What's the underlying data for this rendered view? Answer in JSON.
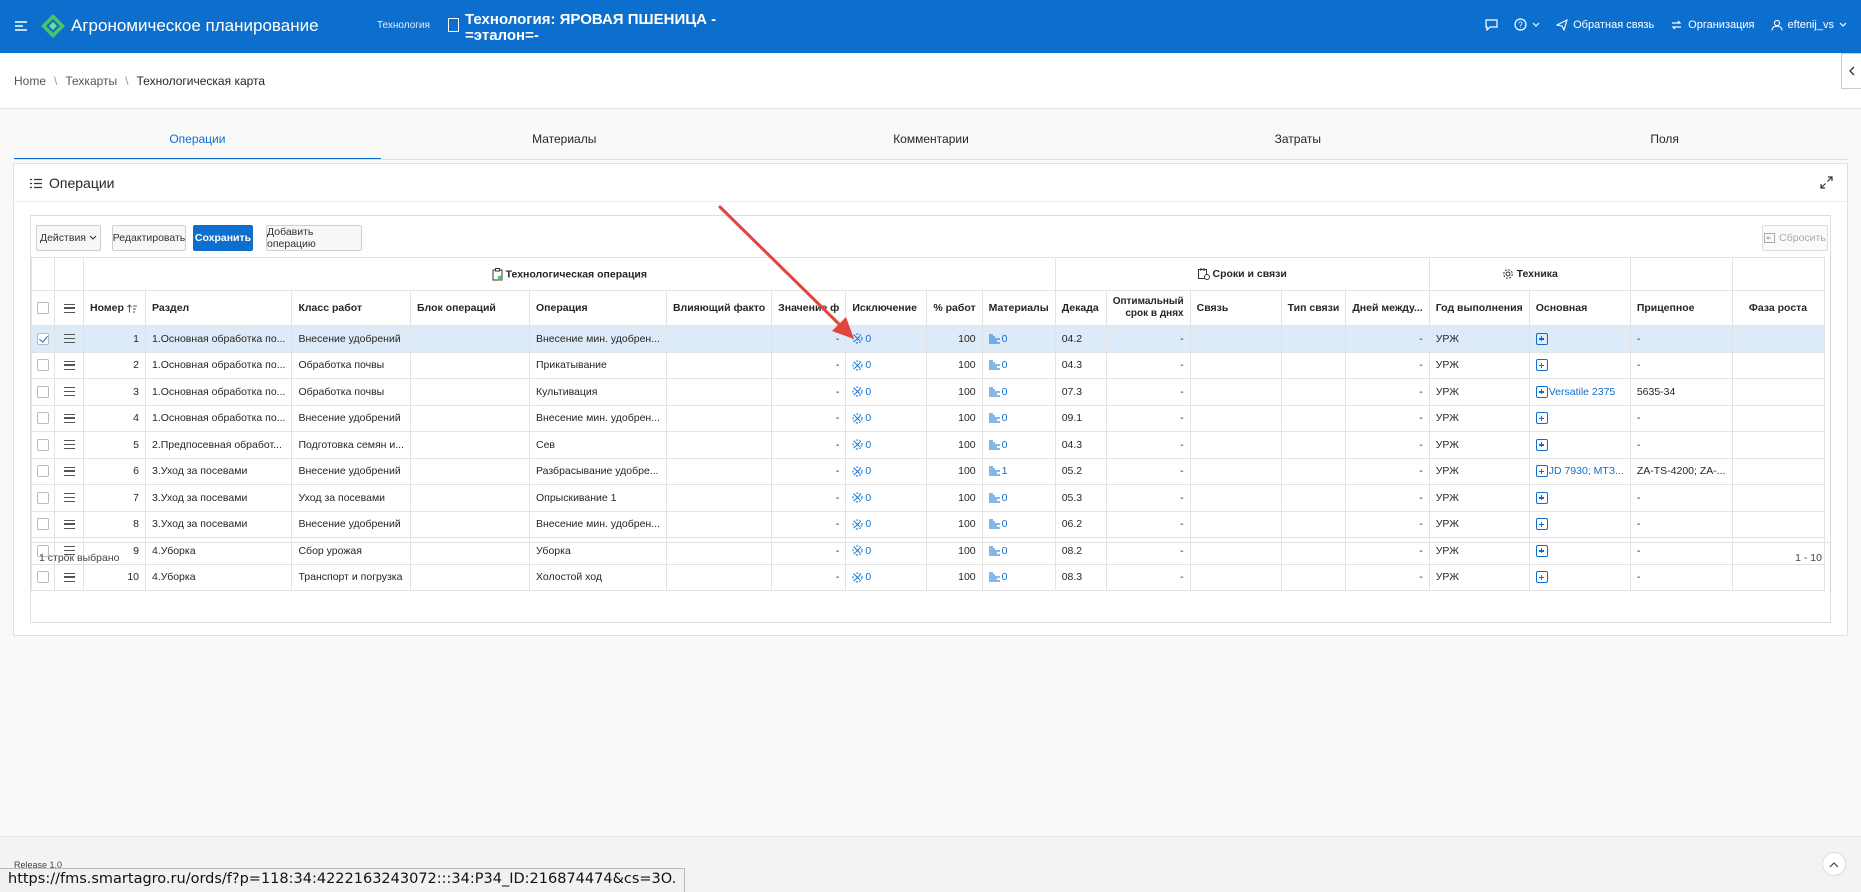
{
  "header": {
    "app_title": "Агрономическое планирование",
    "context_label": "Технология",
    "doc_title_line1": "Технология: ЯРОВАЯ ПШЕНИЦА -",
    "doc_title_line2": "=эталон=-",
    "feedback": "Обратная связь",
    "organization": "Организация",
    "user": "eftenij_vs"
  },
  "breadcrumb": [
    "Home",
    "Техкарты",
    "Технологическая карта"
  ],
  "tabs": [
    "Операции",
    "Материалы",
    "Комментарии",
    "Затраты",
    "Поля"
  ],
  "region": {
    "title": "Операции"
  },
  "toolbar": {
    "actions": "Действия",
    "edit": "Редактировать",
    "save": "Сохранить",
    "add": "Добавить операцию",
    "reset": "Сбросить"
  },
  "groups": {
    "tech_op": "Технологическая операция",
    "terms": "Сроки и связи",
    "machinery": "Техника"
  },
  "columns": [
    "Номер",
    "Раздел",
    "Класс работ",
    "Блок операций",
    "Операция",
    "Влияющий факто",
    "Значение ф",
    "Исключение",
    "% работ",
    "Материалы",
    "Декада",
    "Оптимальный срок в днях",
    "Связь",
    "Тип связи",
    "Дней между...",
    "Год выполнения",
    "Основная",
    "Прицепное",
    "Фаза роста"
  ],
  "rows": [
    {
      "n": "1",
      "section": "1.Основная обработка по...",
      "cls": "Внесение удобрений",
      "block": "",
      "op": "Внесение мин. удобрен...",
      "factor": "",
      "val": "-",
      "exc": "0",
      "pct": "100",
      "mat": "0",
      "dec": "04.2",
      "opt": "-",
      "link": "",
      "ltype": "",
      "days": "-",
      "year": "УРЖ",
      "main": "",
      "trail": "-",
      "phase": ""
    },
    {
      "n": "2",
      "section": "1.Основная обработка по...",
      "cls": "Обработка почвы",
      "block": "",
      "op": "Прикатывание",
      "factor": "",
      "val": "-",
      "exc": "0",
      "pct": "100",
      "mat": "0",
      "dec": "04.3",
      "opt": "-",
      "link": "",
      "ltype": "",
      "days": "-",
      "year": "УРЖ",
      "main": "",
      "trail": "-",
      "phase": ""
    },
    {
      "n": "3",
      "section": "1.Основная обработка по...",
      "cls": "Обработка почвы",
      "block": "",
      "op": "Культивация",
      "factor": "",
      "val": "-",
      "exc": "0",
      "pct": "100",
      "mat": "0",
      "dec": "07.3",
      "opt": "-",
      "link": "",
      "ltype": "",
      "days": "-",
      "year": "УРЖ",
      "main": "Versatile 2375",
      "trail": "5635-34",
      "phase": ""
    },
    {
      "n": "4",
      "section": "1.Основная обработка по...",
      "cls": "Внесение удобрений",
      "block": "",
      "op": "Внесение мин. удобрен...",
      "factor": "",
      "val": "-",
      "exc": "0",
      "pct": "100",
      "mat": "0",
      "dec": "09.1",
      "opt": "-",
      "link": "",
      "ltype": "",
      "days": "-",
      "year": "УРЖ",
      "main": "",
      "trail": "-",
      "phase": ""
    },
    {
      "n": "5",
      "section": "2.Предпосевная обработ...",
      "cls": "Подготовка семян и...",
      "block": "",
      "op": "Сев",
      "factor": "",
      "val": "-",
      "exc": "0",
      "pct": "100",
      "mat": "0",
      "dec": "04.3",
      "opt": "-",
      "link": "",
      "ltype": "",
      "days": "-",
      "year": "УРЖ",
      "main": "",
      "trail": "-",
      "phase": ""
    },
    {
      "n": "6",
      "section": "3.Уход за посевами",
      "cls": "Внесение удобрений",
      "block": "",
      "op": "Разбрасывание удобре...",
      "factor": "",
      "val": "-",
      "exc": "0",
      "pct": "100",
      "mat": "1",
      "dec": "05.2",
      "opt": "-",
      "link": "",
      "ltype": "",
      "days": "-",
      "year": "УРЖ",
      "main": "JD 7930; МТЗ...",
      "trail": "ZA-TS-4200; ZA-...",
      "phase": ""
    },
    {
      "n": "7",
      "section": "3.Уход за посевами",
      "cls": "Уход за посевами",
      "block": "",
      "op": "Опрыскивание 1",
      "factor": "",
      "val": "-",
      "exc": "0",
      "pct": "100",
      "mat": "0",
      "dec": "05.3",
      "opt": "-",
      "link": "",
      "ltype": "",
      "days": "-",
      "year": "УРЖ",
      "main": "",
      "trail": "-",
      "phase": ""
    },
    {
      "n": "8",
      "section": "3.Уход за посевами",
      "cls": "Внесение удобрений",
      "block": "",
      "op": "Внесение мин. удобрен...",
      "factor": "",
      "val": "-",
      "exc": "0",
      "pct": "100",
      "mat": "0",
      "dec": "06.2",
      "opt": "-",
      "link": "",
      "ltype": "",
      "days": "-",
      "year": "УРЖ",
      "main": "",
      "trail": "-",
      "phase": ""
    },
    {
      "n": "9",
      "section": "4.Уборка",
      "cls": "Сбор урожая",
      "block": "",
      "op": "Уборка",
      "factor": "",
      "val": "-",
      "exc": "0",
      "pct": "100",
      "mat": "0",
      "dec": "08.2",
      "opt": "-",
      "link": "",
      "ltype": "",
      "days": "-",
      "year": "УРЖ",
      "main": "",
      "trail": "-",
      "phase": ""
    },
    {
      "n": "10",
      "section": "4.Уборка",
      "cls": "Транспорт и погрузка",
      "block": "",
      "op": "Холостой ход",
      "factor": "",
      "val": "-",
      "exc": "0",
      "pct": "100",
      "mat": "0",
      "dec": "08.3",
      "opt": "-",
      "link": "",
      "ltype": "",
      "days": "-",
      "year": "УРЖ",
      "main": "",
      "trail": "-",
      "phase": ""
    }
  ],
  "footer": {
    "selected": "1 строк выбрано",
    "range": "1 - 10",
    "release": "Release 1.0"
  },
  "status_url": "https://fms.smartagro.ru/ords/f?p=118:34:4222163243072:::34:P34_ID:216874474&cs=3O.",
  "colors": {
    "brand": "#0d6fcd",
    "arrow": "#e2453c"
  }
}
